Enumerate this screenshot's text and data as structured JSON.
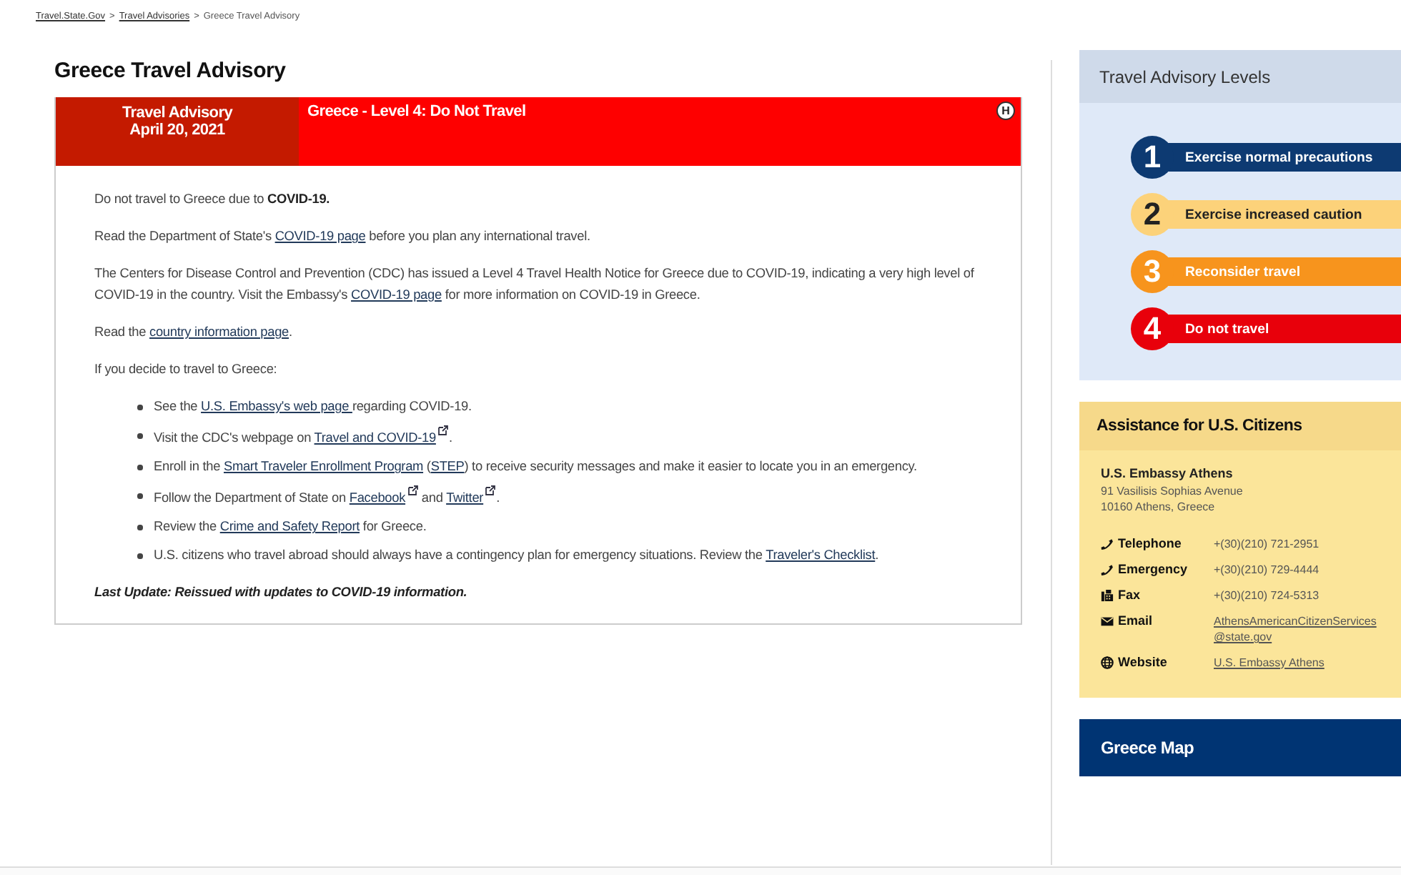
{
  "breadcrumb": [
    {
      "text": "Travel.State.Gov",
      "kind": "link"
    },
    {
      "text": ">",
      "kind": "text"
    },
    {
      "text": "Travel Advisories",
      "kind": "link"
    },
    {
      "text": ">",
      "kind": "text"
    },
    {
      "text": "Greece Travel Advisory",
      "kind": "text"
    }
  ],
  "page_title": "Greece Travel Advisory",
  "advisory": {
    "date_label": "Travel Advisory",
    "date": "April 20, 2021",
    "level_title": "Greece - Level 4: Do Not Travel",
    "badge": "H",
    "paragraphs": [
      [
        {
          "kind": "text",
          "text": "Do not travel to Greece due to "
        },
        {
          "kind": "bold",
          "text": "COVID-19."
        }
      ],
      [
        {
          "kind": "text",
          "text": "Read the Department of State's "
        },
        {
          "kind": "link",
          "text": "COVID-19 page"
        },
        {
          "kind": "text",
          "text": " before you plan any international travel."
        }
      ],
      [
        {
          "kind": "text",
          "text": "The Centers for Disease Control and Prevention (CDC) has issued a Level 4 Travel Health Notice for Greece due to COVID-19, indicating a very high level of COVID-19 in the country. Visit the Embassy's "
        },
        {
          "kind": "link",
          "text": "COVID-19 page"
        },
        {
          "kind": "text",
          "text": " for more information on COVID-19 in Greece."
        }
      ],
      [
        {
          "kind": "text",
          "text": "Read the "
        },
        {
          "kind": "link",
          "text": "country information page"
        },
        {
          "kind": "text",
          "text": "."
        }
      ],
      [
        {
          "kind": "text",
          "text": "If you decide to travel to Greece:"
        }
      ]
    ],
    "bullets": [
      [
        {
          "kind": "text",
          "text": "See the "
        },
        {
          "kind": "link",
          "text": "U.S. Embassy's web page "
        },
        {
          "kind": "text",
          "text": "regarding COVID-19."
        }
      ],
      [
        {
          "kind": "text",
          "text": "Visit the CDC's webpage on "
        },
        {
          "kind": "extlink",
          "text": "Travel and COVID-19"
        },
        {
          "kind": "text",
          "text": "."
        }
      ],
      [
        {
          "kind": "text",
          "text": "Enroll in the "
        },
        {
          "kind": "link",
          "text": "Smart Traveler Enrollment Program"
        },
        {
          "kind": "text",
          "text": " ("
        },
        {
          "kind": "link",
          "text": "STEP"
        },
        {
          "kind": "text",
          "text": ") to receive security messages and make it easier to locate you in an emergency."
        }
      ],
      [
        {
          "kind": "text",
          "text": "Follow the Department of State on "
        },
        {
          "kind": "extlink",
          "text": "Facebook"
        },
        {
          "kind": "text",
          "text": " and "
        },
        {
          "kind": "extlink",
          "text": "Twitter"
        },
        {
          "kind": "text",
          "text": "."
        }
      ],
      [
        {
          "kind": "text",
          "text": "Review the "
        },
        {
          "kind": "link",
          "text": "Crime and Safety Report"
        },
        {
          "kind": "text",
          "text": " for Greece."
        }
      ],
      [
        {
          "kind": "text",
          "text": "U.S. citizens who travel abroad should always have a contingency plan for emergency situations. Review the "
        },
        {
          "kind": "link",
          "text": "Traveler's Checklist"
        },
        {
          "kind": "text",
          "text": "."
        }
      ]
    ],
    "last_update": "Last Update: Reissued with updates to COVID-19 information."
  },
  "levels_panel": {
    "title": "Travel Advisory Levels",
    "levels": [
      {
        "number": "1",
        "label": "Exercise normal precautions",
        "color": "#0d3a72"
      },
      {
        "number": "2",
        "label": "Exercise increased caution",
        "color": "#fcd27a"
      },
      {
        "number": "3",
        "label": "Reconsider travel",
        "color": "#f7941d"
      },
      {
        "number": "4",
        "label": "Do not travel",
        "color": "#e8000b"
      }
    ]
  },
  "assistance": {
    "title": "Assistance for U.S. Citizens",
    "office": "U.S. Embassy Athens",
    "address": [
      "91 Vasilisis Sophias Avenue",
      "10160 Athens, Greece"
    ],
    "contacts": [
      {
        "kind": "phone",
        "label": "Telephone",
        "value_lines": [
          "+(30)(210) 721-2951"
        ]
      },
      {
        "kind": "phone",
        "label": "Emergency",
        "value_lines": [
          "+(30)(210) 729-4444"
        ]
      },
      {
        "kind": "fax",
        "label": "Fax",
        "value_lines": [
          "+(30)(210) 724-5313"
        ]
      },
      {
        "kind": "email",
        "label": "Email",
        "value_lines": [
          "AthensAmericanCitizenServices",
          "@state.gov"
        ]
      },
      {
        "kind": "web",
        "label": "Website",
        "value_lines": [
          "U.S. Embassy Athens"
        ]
      }
    ]
  },
  "map_panel": {
    "title": "Greece Map"
  }
}
